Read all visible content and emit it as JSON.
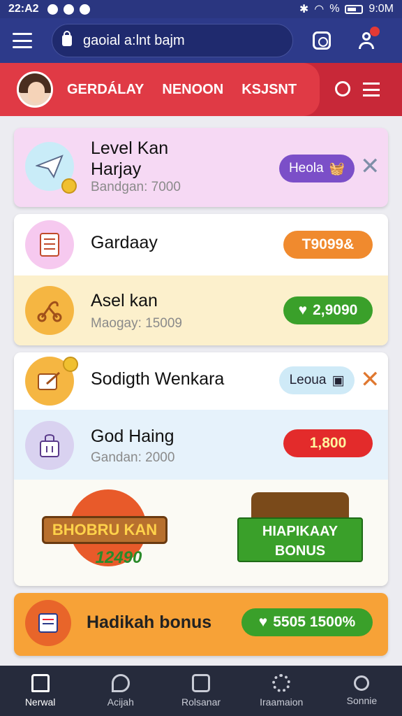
{
  "status_bar": {
    "time": "22:A2",
    "right_time": "9:0M",
    "signal": "%"
  },
  "search": {
    "text": "gaoial a:lnt bajm"
  },
  "header": {
    "tabs": [
      "GERDÁLAY",
      "NENOON",
      "KSJSNT"
    ]
  },
  "cards": {
    "level": {
      "title_line1": "Level Kan",
      "title_line2": "Harjay",
      "sub": "Bandgan: 7000",
      "button": "Heola",
      "color": "#7b4fc8"
    },
    "gardaay": {
      "title": "Gardaay",
      "button": "T9099&",
      "color": "#f08a2e"
    },
    "asel": {
      "title": "Asel kan",
      "sub": "Maogay: 15009",
      "button": "2,9090",
      "color": "#3aa02a"
    },
    "sodigth": {
      "title": "Sodigth Wenkara",
      "button": "Leoua",
      "color": "#cfeaf7"
    },
    "god": {
      "title": "God Haing",
      "sub": "Gandan: 2000",
      "button": "1,800",
      "color": "#e32b2b"
    },
    "banner": {
      "left_text": "BHOBRU KAN",
      "left_number": "12490",
      "right_line1": "HIAPIKAAY",
      "right_line2": "BONUS"
    },
    "bonus": {
      "title": "Hadikah bonus",
      "button": "5505 1500%",
      "color": "#3aa02a"
    }
  },
  "nav": {
    "items": [
      {
        "label": "Nerwal",
        "icon": "home-icon"
      },
      {
        "label": "Acijah",
        "icon": "chat-icon"
      },
      {
        "label": "Rolsanar",
        "icon": "edit-icon"
      },
      {
        "label": "Iraamaion",
        "icon": "settings-icon"
      },
      {
        "label": "Sonnie",
        "icon": "person-icon"
      }
    ]
  }
}
